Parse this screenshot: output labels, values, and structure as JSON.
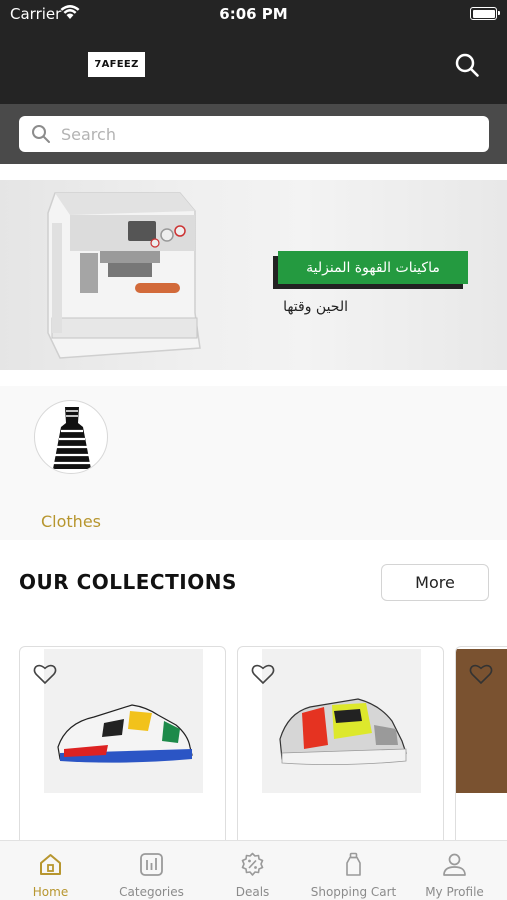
{
  "status_bar": {
    "carrier": "Carrier",
    "time": "6:06 PM"
  },
  "header": {
    "logo_text": "7AFEEZ"
  },
  "search": {
    "placeholder": "Search"
  },
  "banner": {
    "headline": "ماكينات القهوة المنزلية",
    "subline": "الحين وقتها"
  },
  "categories": [
    {
      "label": "Clothes"
    }
  ],
  "collections": {
    "title": "OUR COLLECTIONS",
    "more_label": "More"
  },
  "tabs": [
    {
      "label": "Home",
      "icon": "home-icon",
      "active": true
    },
    {
      "label": "Categories",
      "icon": "categories-icon",
      "active": false
    },
    {
      "label": "Deals",
      "icon": "deals-icon",
      "active": false
    },
    {
      "label": "Shopping Cart",
      "icon": "cart-icon",
      "active": false
    },
    {
      "label": "My Profile",
      "icon": "profile-icon",
      "active": false
    }
  ],
  "colors": {
    "accent": "#B7962F",
    "header_bg": "#242424",
    "banner_pill": "#249A40"
  }
}
